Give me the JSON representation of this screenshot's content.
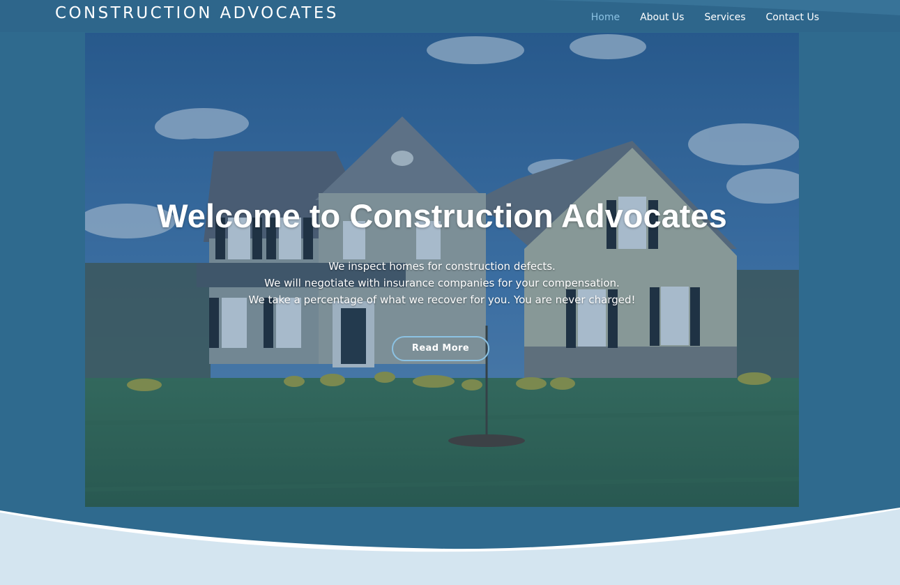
{
  "header": {
    "brand": "CONSTRUCTION ADVOCATES",
    "nav": [
      {
        "label": "Home",
        "active": true
      },
      {
        "label": "About Us",
        "active": false
      },
      {
        "label": "Services",
        "active": false
      },
      {
        "label": "Contact Us",
        "active": false
      }
    ]
  },
  "hero": {
    "title": "Welcome to Construction Advocates",
    "lines": [
      "We inspect homes for construction defects.",
      "We will negotiate with insurance companies for your compensation.",
      "We take a percentage of what we recover for you. You are never charged!"
    ],
    "button_label": "Read More",
    "image_subject": "two-story suburban house with lawn under cloudy blue sky"
  },
  "colors": {
    "header_bg": "#2e6489",
    "overlay": "#2b5f86",
    "accent": "#8cc2e3",
    "wave_light": "#d4e5f0",
    "text": "#ffffff"
  }
}
